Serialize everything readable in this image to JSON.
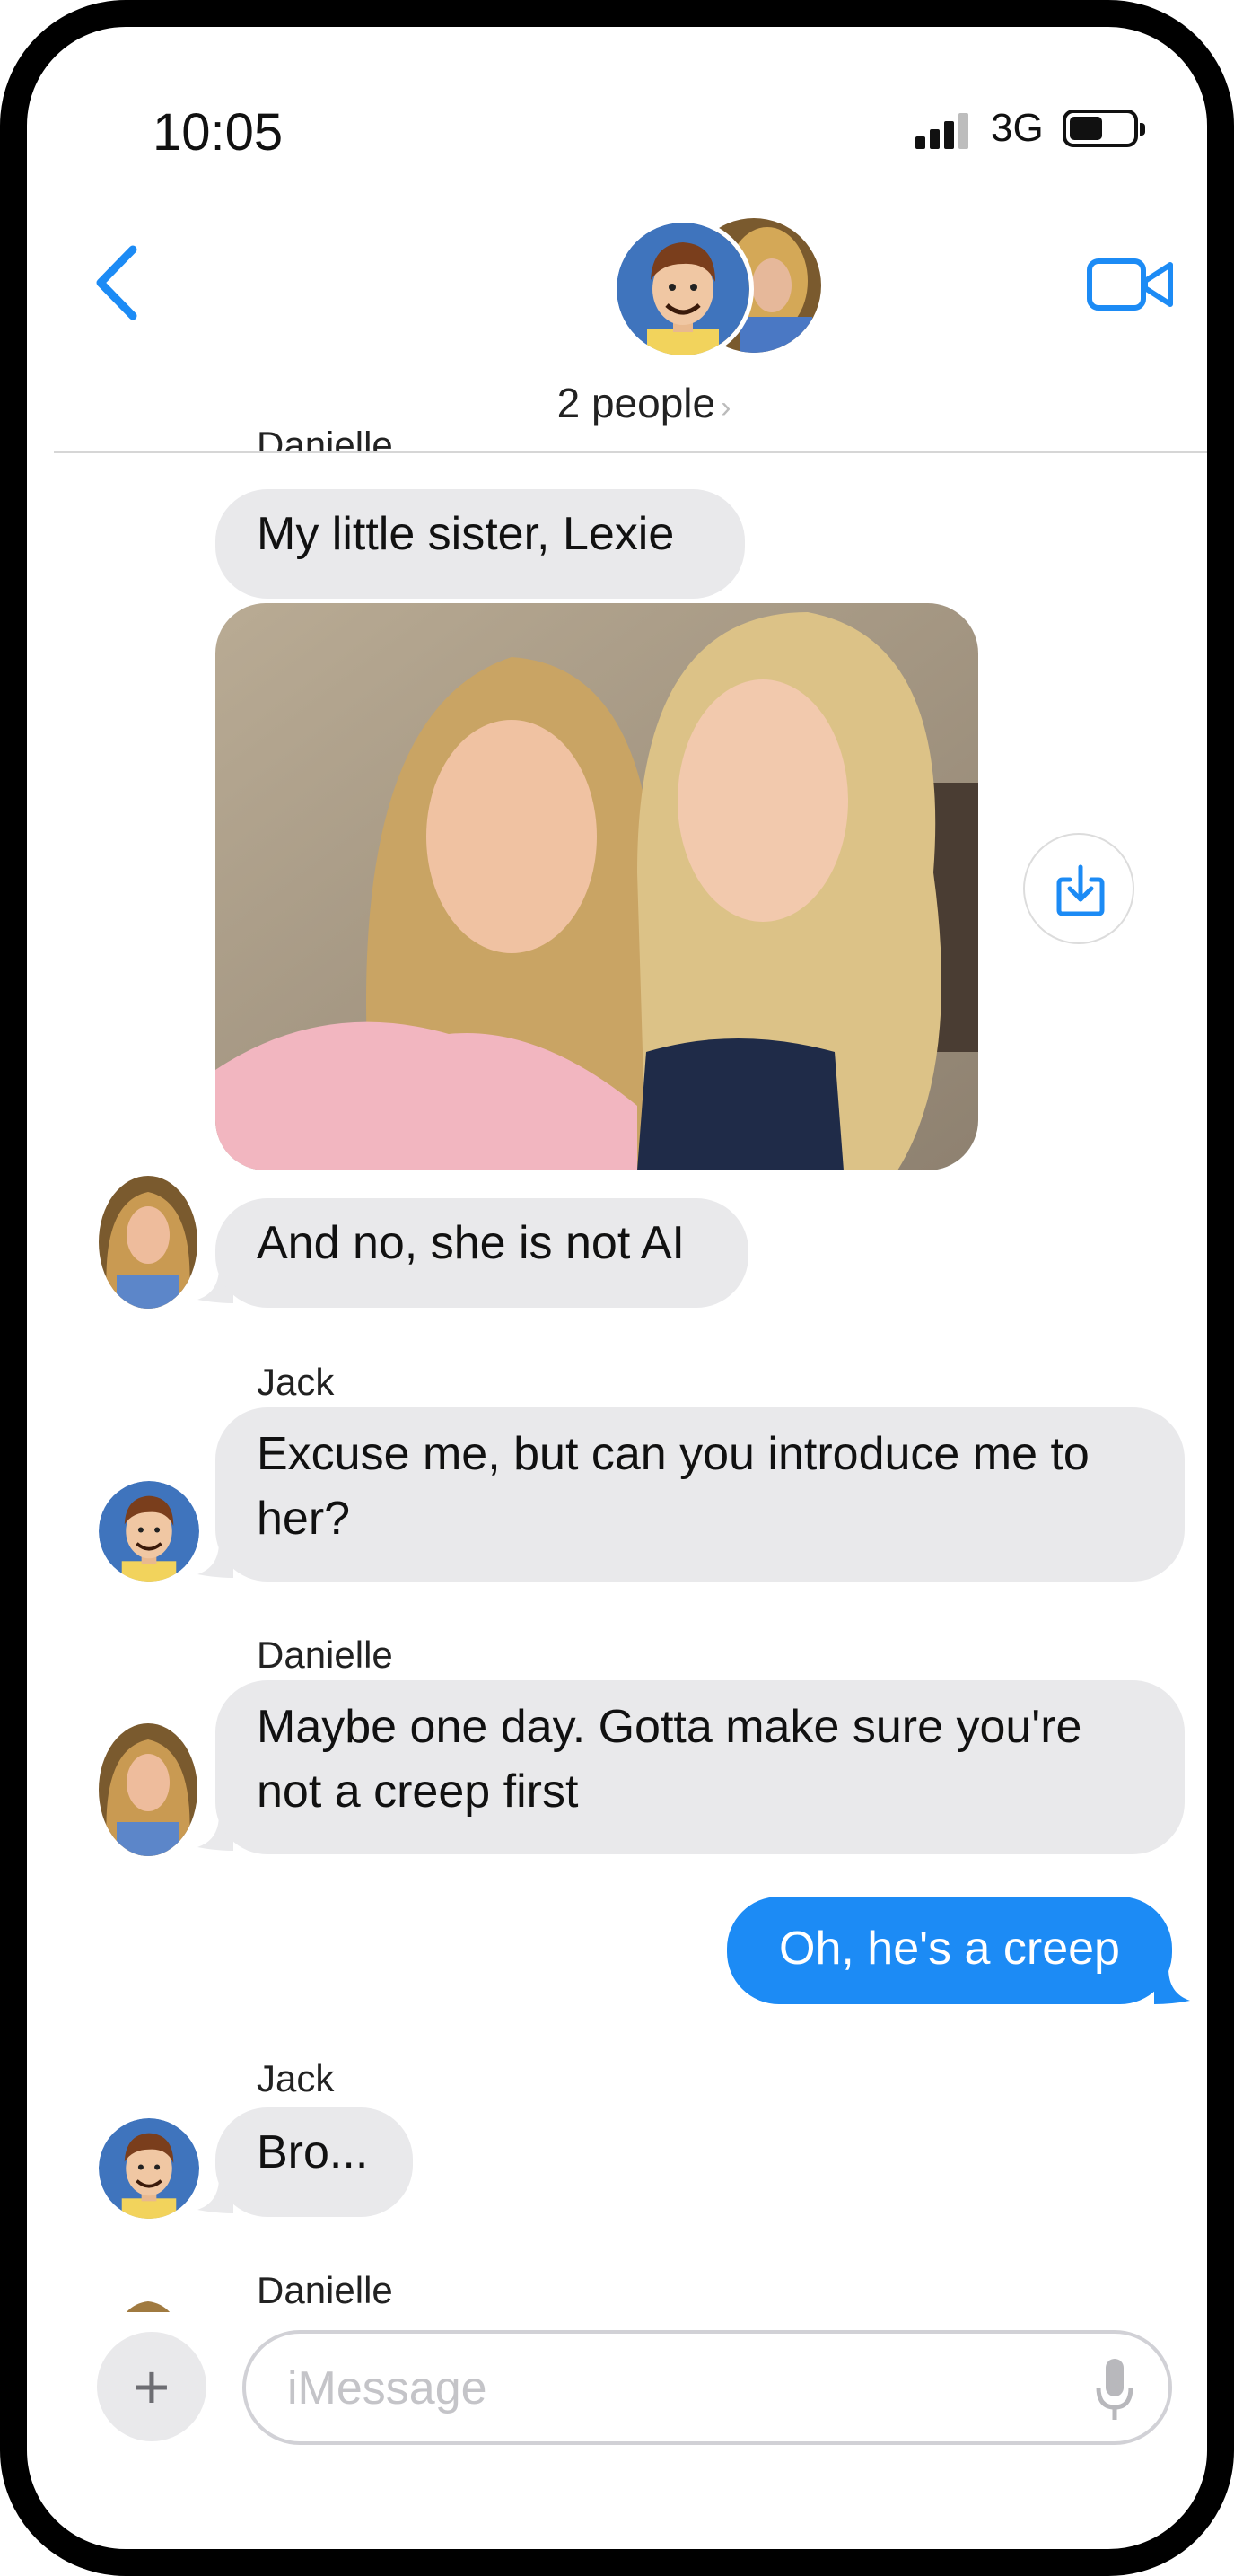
{
  "status_bar": {
    "time": "10:05",
    "network": "3G"
  },
  "header": {
    "people_label": "2 people",
    "chevron": "›"
  },
  "messages": [
    {
      "sender": "Danielle",
      "text": "My little sister, Lexie"
    },
    {
      "sender": "Danielle",
      "text": "And no, she is not AI"
    },
    {
      "sender": "Jack",
      "text": "Excuse me, but can you introduce me to her?"
    },
    {
      "sender": "Danielle",
      "text": "Maybe one day.  Gotta make sure you're not a creep first"
    },
    {
      "sender": "me",
      "text": "Oh, he's a creep"
    },
    {
      "sender": "Jack",
      "text": "Bro..."
    },
    {
      "sender": "Danielle",
      "text": ""
    }
  ],
  "input": {
    "placeholder": "iMessage",
    "plus_label": "+"
  },
  "colors": {
    "accent": "#1c8bf5",
    "bubble_gray": "#e9e9eb",
    "frame": "#000000"
  },
  "icons": [
    "back-chevron-icon",
    "video-camera-icon",
    "save-download-icon",
    "plus-icon",
    "microphone-icon",
    "signal-icon",
    "battery-icon"
  ]
}
